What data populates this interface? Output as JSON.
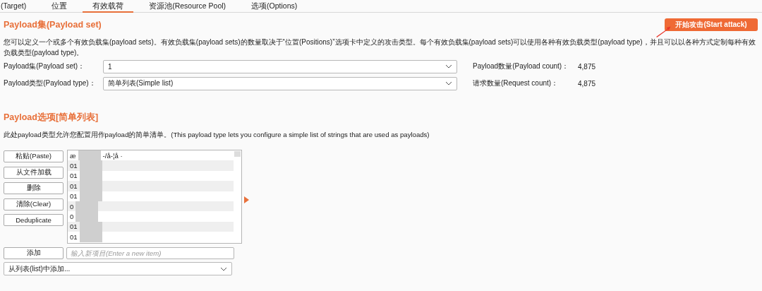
{
  "tabs": [
    {
      "label": "(Target)",
      "selected": false
    },
    {
      "label": "位置",
      "selected": false
    },
    {
      "label": "有效载荷",
      "selected": true
    },
    {
      "label": "资源池(Resource Pool)",
      "selected": false
    },
    {
      "label": "选项(Options)",
      "selected": false
    }
  ],
  "payload_sets": {
    "title": "Payload集(Payload set)",
    "start_button": "开始攻击(Start attack)",
    "description": "您可以定义一个或多个有效负载集(payload sets)。有效负载集(payload sets)的数量取决于“位置(Positions)”选项卡中定义的攻击类型。每个有效负载集(payload sets)可以使用各种有效负载类型(payload type)，并且可以以各种方式定制每种有效负载类型(payload type)。",
    "fields": [
      {
        "label": "Payload集(Payload set)：",
        "value": "1",
        "info_label": "Payload数量(Payload count)：",
        "info_value": "4,875"
      },
      {
        "label": "Payload类型(Payload type)：",
        "value": "简单列表(Simple list)",
        "info_label": "请求数量(Request count)：",
        "info_value": "4,875"
      }
    ]
  },
  "payload_options": {
    "title": "Payload选项[简单列表]",
    "description": "此处payload类型允许您配置用作payload的简单清单。(This payload type lets you configure a simple list of strings that are used as payloads)",
    "buttons": [
      "粘贴(Paste)",
      "从文件加载",
      "删除",
      "清除(Clear)",
      "Deduplicate"
    ],
    "items": [
      {
        "lead": "æ",
        "tail": "-/å-¦å ·"
      },
      {
        "lead": "01"
      },
      {
        "lead": "01"
      },
      {
        "lead": "01"
      },
      {
        "lead": "01"
      },
      {
        "lead": "0"
      },
      {
        "lead": "0"
      },
      {
        "lead": "01"
      },
      {
        "lead": "01"
      }
    ],
    "add_button": "添加",
    "add_placeholder": "输入新项目(Enter a new item)",
    "list_dropdown": "从列表(list)中添加..."
  }
}
